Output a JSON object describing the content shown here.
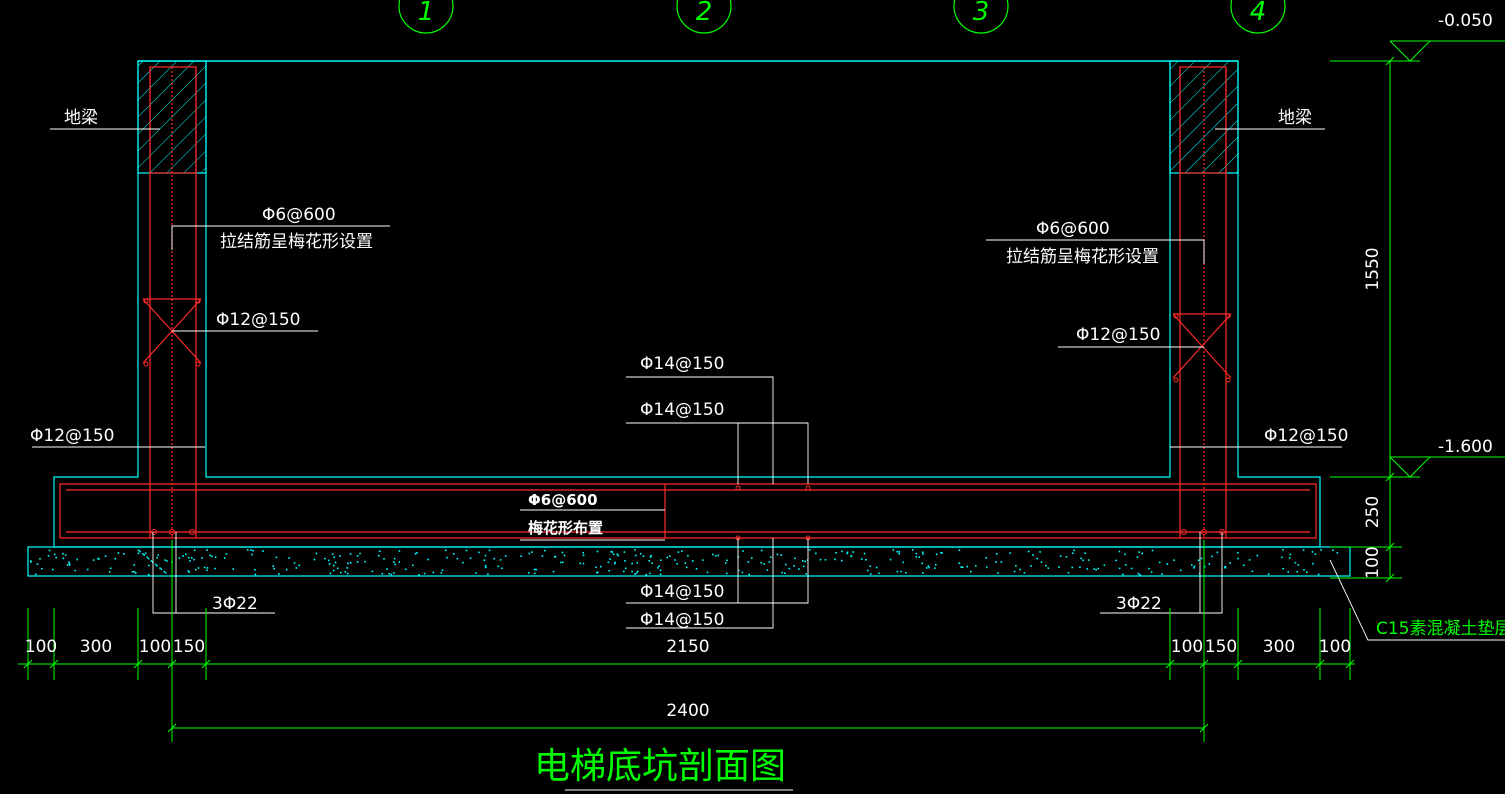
{
  "title": "电梯底坑剖面图",
  "axes": [
    "1",
    "2",
    "3",
    "4"
  ],
  "elevations": {
    "top": "-0.050",
    "bottom": "-1.600"
  },
  "beam_labels": {
    "left": "地梁",
    "right": "地梁"
  },
  "rebar": {
    "tie_left": "Φ6@600",
    "tie_left_note": "拉结筋呈梅花形设置",
    "tie_right": "Φ6@600",
    "tie_right_note": "拉结筋呈梅花形设置",
    "wall_left_inner": "Φ12@150",
    "wall_left_outer": "Φ12@150",
    "wall_right_inner": "Φ12@150",
    "wall_right_outer": "Φ12@150",
    "slab_top_1": "Φ14@150",
    "slab_top_2": "Φ14@150",
    "slab_bot_1": "Φ14@150",
    "slab_bot_2": "Φ14@150",
    "slab_tie": "Φ6@600",
    "slab_tie_note": "梅花形布置",
    "corner_left": "3Φ22",
    "corner_right": "3Φ22"
  },
  "cushion_label": "C15素混凝土垫层",
  "dimensions": {
    "bottom_row": [
      "100",
      "300",
      "100",
      "150",
      "2150",
      "100",
      "150",
      "300",
      "100"
    ],
    "overall": "2400",
    "right_vertical": [
      "1550",
      "250",
      "100"
    ]
  },
  "colors": {
    "background": "#000000",
    "outline": "#00ffff",
    "rebar": "#ff2a2a",
    "text": "#ffffff",
    "dimension": "#00ff00",
    "leader": "#ffffff"
  }
}
